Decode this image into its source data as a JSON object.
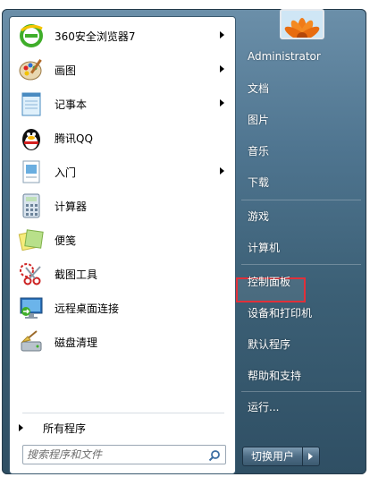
{
  "programs": [
    {
      "label": "360安全浏览器7",
      "icon": "360-browser-icon",
      "has_submenu": true
    },
    {
      "label": "画图",
      "icon": "paint-palette-icon",
      "has_submenu": true
    },
    {
      "label": "记事本",
      "icon": "notepad-icon",
      "has_submenu": true
    },
    {
      "label": "腾讯QQ",
      "icon": "qq-penguin-icon",
      "has_submenu": false
    },
    {
      "label": "入门",
      "icon": "getting-started-icon",
      "has_submenu": true
    },
    {
      "label": "计算器",
      "icon": "calculator-icon",
      "has_submenu": false
    },
    {
      "label": "便笺",
      "icon": "sticky-notes-icon",
      "has_submenu": false
    },
    {
      "label": "截图工具",
      "icon": "snipping-tool-icon",
      "has_submenu": false
    },
    {
      "label": "远程桌面连接",
      "icon": "remote-desktop-icon",
      "has_submenu": false
    },
    {
      "label": "磁盘清理",
      "icon": "disk-cleanup-icon",
      "has_submenu": false
    }
  ],
  "all_programs": "所有程序",
  "search": {
    "placeholder": "搜索程序和文件"
  },
  "right": {
    "user": "Administrator",
    "documents": "文档",
    "pictures": "图片",
    "music": "音乐",
    "downloads": "下载",
    "games": "游戏",
    "computer": "计算机",
    "control_panel": "控制面板",
    "devices_printers": "设备和打印机",
    "default_programs": "默认程序",
    "help_support": "帮助和支持",
    "run": "运行..."
  },
  "shutdown_label": "切换用户",
  "colors": {
    "highlight": "#e0303a",
    "pane_dark": "#3c6076",
    "text_white": "#ffffff"
  }
}
